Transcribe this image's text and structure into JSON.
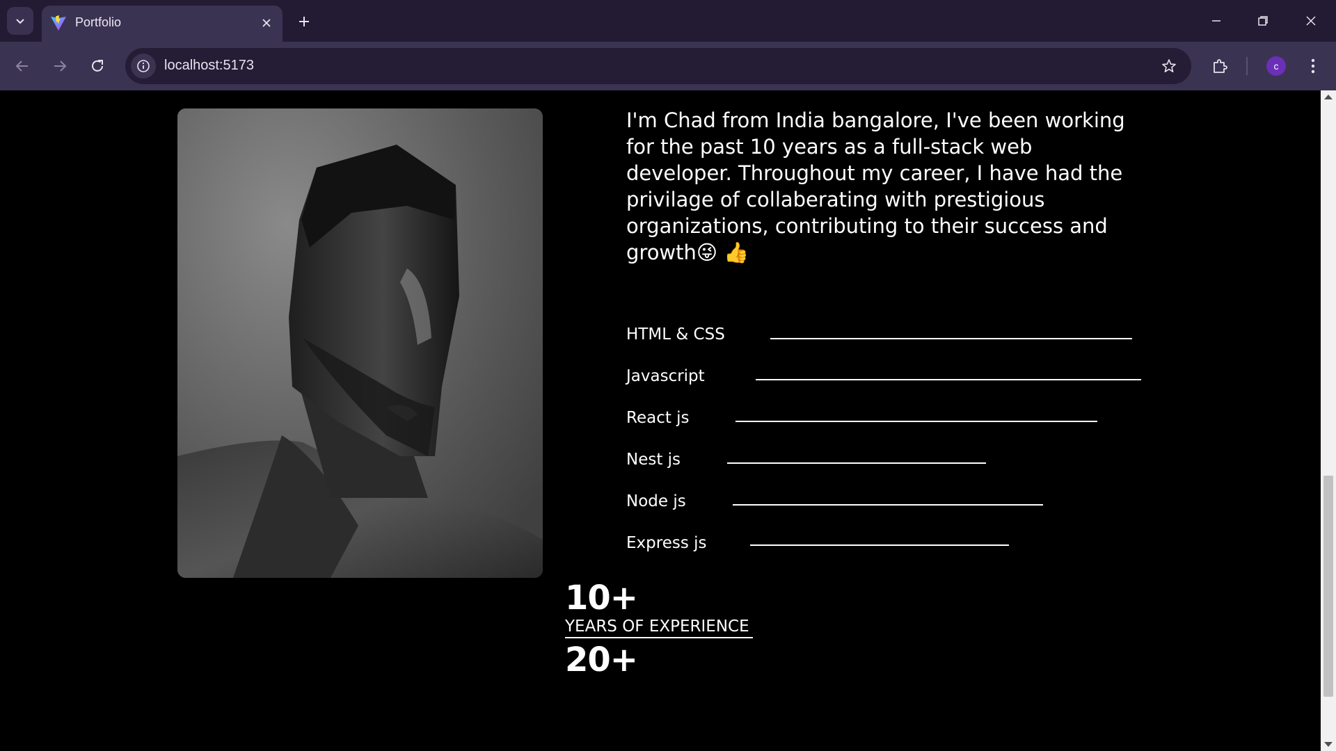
{
  "browser": {
    "tab_title": "Portfolio",
    "url": "localhost:5173",
    "profile_initial": "c",
    "accent": "#6b2fb8",
    "icons": [
      "tab-list-icon",
      "vite-favicon-icon",
      "close-icon",
      "plus-icon",
      "minimize-icon",
      "restore-icon",
      "window-close-icon",
      "back-icon",
      "forward-icon",
      "reload-icon",
      "site-info-icon",
      "star-icon",
      "extensions-icon",
      "menu-dots-icon"
    ]
  },
  "about": {
    "bio": "I'm Chad from India bangalore, I've been working for the past 10 years as a full-stack web developer. Throughout my career, I have had the privilage of collaberating with prestigious organizations, contributing to their success and growth😜 👍"
  },
  "skills": [
    {
      "name": "HTML & CSS"
    },
    {
      "name": "Javascript"
    },
    {
      "name": "React js"
    },
    {
      "name": "Nest js"
    },
    {
      "name": "Node js"
    },
    {
      "name": "Express js"
    }
  ],
  "stats": [
    {
      "value": "10+",
      "label": "YEARS OF EXPERIENCE"
    },
    {
      "value": "20+"
    }
  ]
}
